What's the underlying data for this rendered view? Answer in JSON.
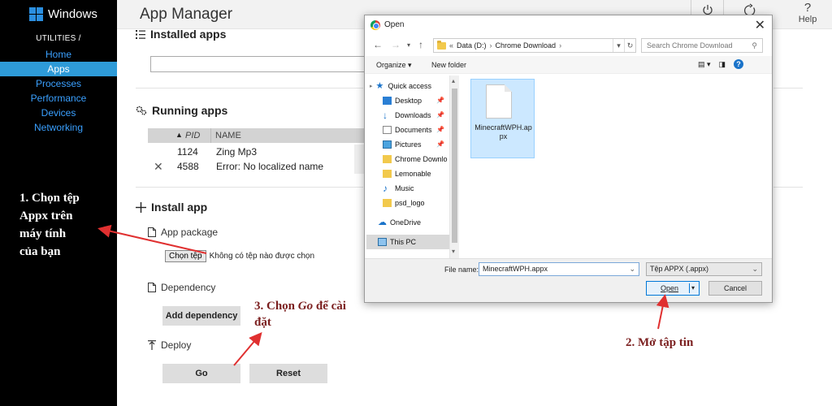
{
  "sidebar": {
    "brand": "Windows",
    "section": "UTILITIES /",
    "items": [
      {
        "label": "Home",
        "active": false
      },
      {
        "label": "Apps",
        "active": true
      },
      {
        "label": "Processes",
        "active": false
      },
      {
        "label": "Performance",
        "active": false
      },
      {
        "label": "Devices",
        "active": false
      },
      {
        "label": "Networking",
        "active": false
      }
    ]
  },
  "header": {
    "title": "App Manager",
    "help_label": "Help",
    "help_glyph": "?"
  },
  "installed": {
    "title": "Installed apps"
  },
  "running": {
    "title": "Running apps",
    "columns": [
      "PID",
      "NAME"
    ],
    "rows": [
      {
        "pid": "1124",
        "name": "Zing Mp3"
      },
      {
        "pid": "4588",
        "name": "Error: No localized name"
      }
    ]
  },
  "install": {
    "title": "Install app",
    "app_package_label": "App package",
    "choose_button": "Chọn tệp",
    "no_file_text": "Không có tệp nào được chọn",
    "dependency_label": "Dependency",
    "add_dependency_button": "Add dependency",
    "deploy_label": "Deploy",
    "go_button": "Go",
    "reset_button": "Reset"
  },
  "dialog": {
    "title": "Open",
    "breadcrumb": [
      "«",
      "Data (D:)",
      "›",
      "Chrome Download",
      "›"
    ],
    "search_placeholder": "Search Chrome Download",
    "organize_label": "Organize ▾",
    "new_folder_label": "New folder",
    "tree": [
      {
        "label": "Quick access",
        "icon": "star-icon",
        "pinned": false
      },
      {
        "label": "Desktop",
        "icon": "desktop-icon",
        "pinned": true
      },
      {
        "label": "Downloads",
        "icon": "downloads-icon",
        "pinned": true
      },
      {
        "label": "Documents",
        "icon": "documents-icon",
        "pinned": true
      },
      {
        "label": "Pictures",
        "icon": "pictures-icon",
        "pinned": true
      },
      {
        "label": "Chrome Downlo",
        "icon": "folder-icon",
        "pinned": false
      },
      {
        "label": "Lemonable",
        "icon": "folder-icon",
        "pinned": false
      },
      {
        "label": "Music",
        "icon": "music-icon",
        "pinned": false
      },
      {
        "label": "psd_logo",
        "icon": "folder-icon",
        "pinned": false
      },
      {
        "label": "OneDrive",
        "icon": "onedrive-icon",
        "pinned": false
      },
      {
        "label": "This PC",
        "icon": "this-pc-icon",
        "pinned": false
      }
    ],
    "file": {
      "name": "MinecraftWPH.appx"
    },
    "file_name_label": "File name:",
    "file_name_value": "MinecraftWPH.appx",
    "file_type_value": "Tệp APPX (.appx)",
    "open_button": "Open",
    "cancel_button": "Cancel"
  },
  "annotations": {
    "step1": [
      "1. Chọn tệp",
      "Appx trên",
      "máy tính",
      "của bạn"
    ],
    "step2": "2. Mở tập tin",
    "step3_line1_prefix": "3.  Chọn ",
    "step3_line1_em": "Go",
    "step3_line1_suffix": " để cài",
    "step3_line2": "đặt"
  },
  "colors": {
    "sidebar_bg": "#000000",
    "nav_link": "#3aa0ff",
    "nav_active_bg": "#2e9bd8",
    "annotation_text": "#7b1f1f",
    "arrow": "#e03030",
    "dialog_selected": "#cce8ff"
  }
}
